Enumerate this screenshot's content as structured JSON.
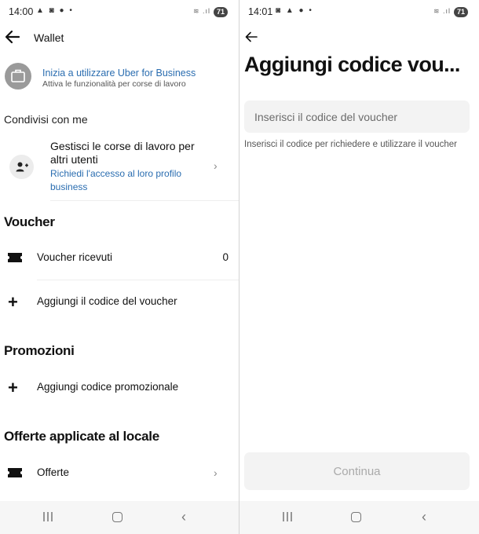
{
  "left_screen": {
    "status_bar": {
      "time": "14:00",
      "icons": "▲ ◙ ● •",
      "signal": "≋ .ıl",
      "battery": "71"
    },
    "header": {
      "back_icon": "arrow-left-icon",
      "title": "Wallet"
    },
    "business": {
      "icon": "briefcase-icon",
      "title": "Inizia a utilizzare Uber for Business",
      "subtitle": "Attiva le funzionalità per corse di lavoro"
    },
    "shared": {
      "heading": "Condivisi con me",
      "item": {
        "icon": "add-person-icon",
        "title": "Gestisci le corse di lavoro per altri utenti",
        "subtitle": "Richiedi l'accesso al loro profilo business",
        "chevron": "›"
      }
    },
    "voucher": {
      "heading": "Voucher",
      "received_label": "Voucher ricevuti",
      "received_count": "0",
      "add_label": "Aggiungi il codice del voucher"
    },
    "promotions": {
      "heading": "Promozioni",
      "add_label": "Aggiungi codice promozionale"
    },
    "local_offers": {
      "heading": "Offerte applicate al locale",
      "offers_label": "Offerte",
      "chevron": "›"
    }
  },
  "right_screen": {
    "status_bar": {
      "time": "14:01",
      "icons": "◙ ▲ ● •",
      "signal": "≋ .ıl",
      "battery": "71"
    },
    "header": {
      "back_icon": "arrow-left-icon"
    },
    "title": "Aggiungi codice vou...",
    "input": {
      "placeholder": "Inserisci il codice del voucher",
      "value": ""
    },
    "helper_text": "Inserisci il codice per richiedere e utilizzare il voucher",
    "continue_label": "Continua"
  },
  "nav_bar": {
    "recent": "recent-apps-icon",
    "home": "home-icon",
    "back": "back-icon",
    "back_glyph": "‹"
  },
  "colors": {
    "link_blue": "#2a6db0",
    "field_bg": "#f3f3f3",
    "nav_bg": "#f6f6f6"
  }
}
